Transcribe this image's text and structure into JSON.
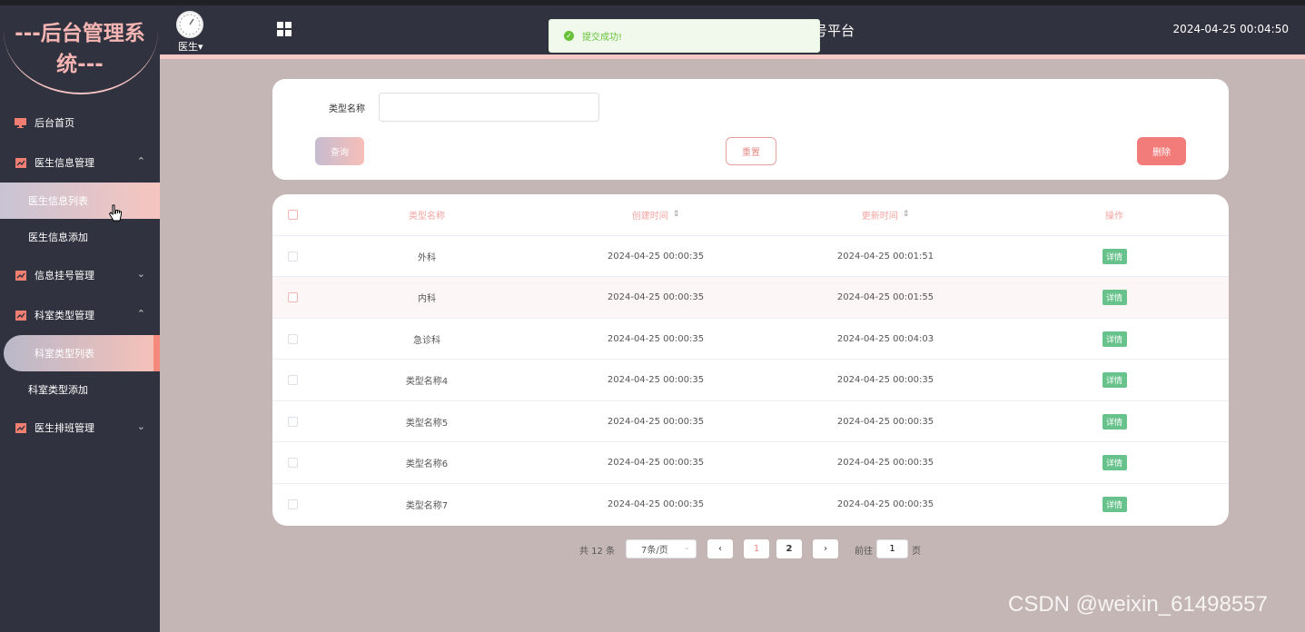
{
  "app": {
    "brand": "---后台管理系统---",
    "title": "号平台",
    "datetime": "2024-04-25 00:04:50",
    "user_label": "医生"
  },
  "toast": {
    "message": "提交成功!",
    "icon": "check-circle-icon",
    "color": "#67c23a"
  },
  "sidebar": {
    "items": [
      {
        "label": "后台首页",
        "icon": "monitor-icon"
      },
      {
        "label": "医生信息管理",
        "icon": "chart-icon",
        "expanded": true,
        "children": [
          {
            "label": "医生信息列表",
            "active": true
          },
          {
            "label": "医生信息添加"
          }
        ]
      },
      {
        "label": "信息挂号管理",
        "icon": "chart-icon",
        "expanded": false
      },
      {
        "label": "科室类型管理",
        "icon": "chart-icon",
        "expanded": true,
        "children": [
          {
            "label": "科室类型列表",
            "active": true
          },
          {
            "label": "科室类型添加"
          }
        ]
      },
      {
        "label": "医生排班管理",
        "icon": "chart-icon",
        "expanded": false
      }
    ]
  },
  "search": {
    "label": "类型名称",
    "value": "",
    "placeholder": "",
    "query_label": "查询",
    "reset_label": "重置",
    "delete_label": "删除"
  },
  "table": {
    "headers": {
      "name": "类型名称",
      "created": "创建时间",
      "updated": "更新时间",
      "op": "操作"
    },
    "detail_label": "详情",
    "rows": [
      {
        "name": "外科",
        "created": "2024-04-25 00:00:35",
        "updated": "2024-04-25 00:01:51"
      },
      {
        "name": "内科",
        "created": "2024-04-25 00:00:35",
        "updated": "2024-04-25 00:01:55"
      },
      {
        "name": "急诊科",
        "created": "2024-04-25 00:00:35",
        "updated": "2024-04-25 00:04:03"
      },
      {
        "name": "类型名称4",
        "created": "2024-04-25 00:00:35",
        "updated": "2024-04-25 00:00:35"
      },
      {
        "name": "类型名称5",
        "created": "2024-04-25 00:00:35",
        "updated": "2024-04-25 00:00:35"
      },
      {
        "name": "类型名称6",
        "created": "2024-04-25 00:00:35",
        "updated": "2024-04-25 00:00:35"
      },
      {
        "name": "类型名称7",
        "created": "2024-04-25 00:00:35",
        "updated": "2024-04-25 00:00:35"
      }
    ]
  },
  "pagination": {
    "total_text": "共 12 条",
    "page_size": "7条/页",
    "prev": "‹",
    "next": "›",
    "pages": [
      "1",
      "2"
    ],
    "current": "1",
    "goto_label": "前往",
    "goto_value": "1",
    "page_suffix": "页"
  },
  "watermark": "CSDN @weixin_61498557",
  "colors": {
    "sidebar_bg": "#30333f",
    "accent_pink": "#f6b5b2",
    "page_bg": "#c4b6b4",
    "detail_green": "#67c28b",
    "delete_red": "#f27c79"
  }
}
